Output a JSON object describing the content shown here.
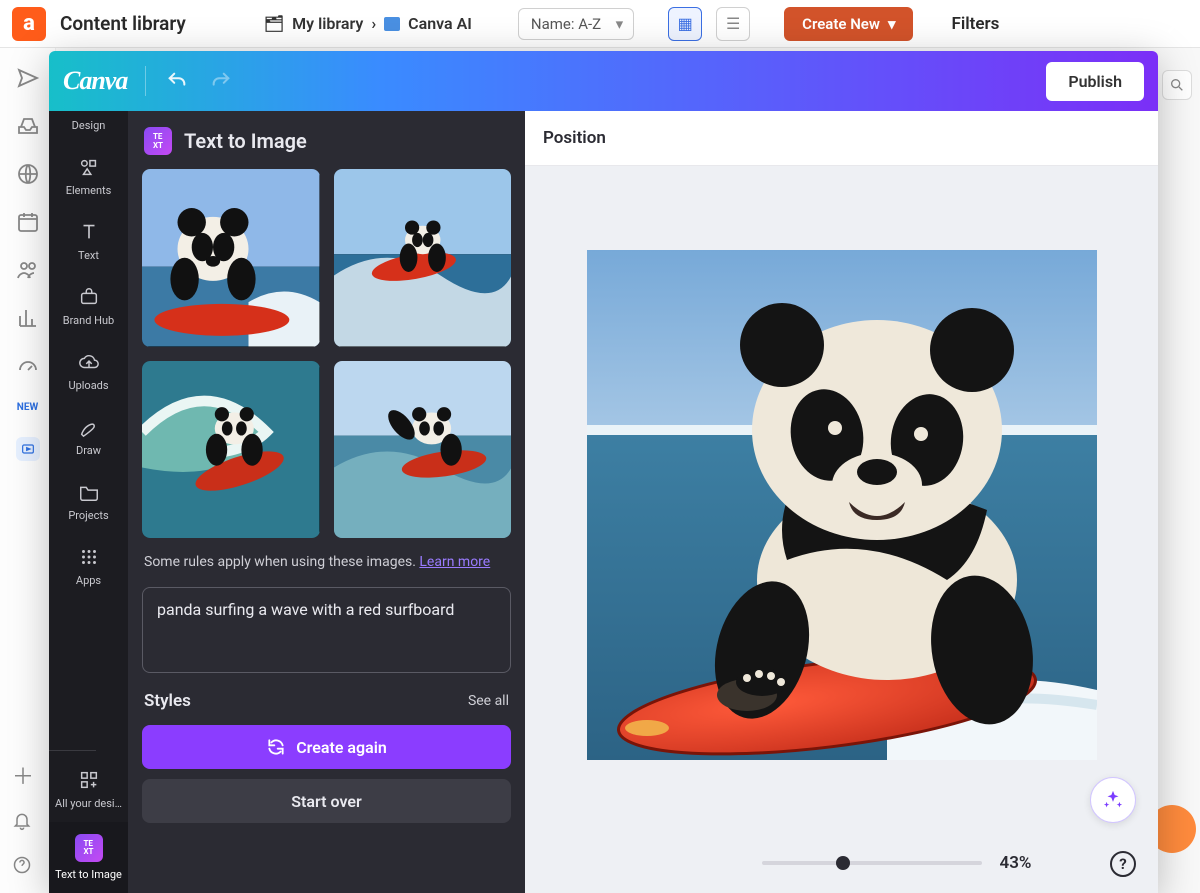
{
  "bg": {
    "title": "Content library",
    "breadcrumb": {
      "root": "My library",
      "current": "Canva AI"
    },
    "sort_label": "Name: A-Z",
    "create_new": "Create New",
    "filters": "Filters",
    "new_badge": "NEW"
  },
  "editor": {
    "logo_text": "Canva",
    "publish": "Publish",
    "position": "Position",
    "zoom_pct": "43%",
    "zoom_value": 0.37
  },
  "rail": {
    "design": "Design",
    "elements": "Elements",
    "text": "Text",
    "brand_hub": "Brand Hub",
    "uploads": "Uploads",
    "draw": "Draw",
    "projects": "Projects",
    "apps": "Apps",
    "all_designs": "All your desi…",
    "text_to_image": "Text to Image"
  },
  "panel": {
    "title": "Text to Image",
    "rules_prefix": "Some rules apply when using these images. ",
    "rules_link": "Learn more",
    "prompt": "panda surfing a wave with a red surfboard",
    "styles_label": "Styles",
    "see_all": "See all",
    "create_again": "Create again",
    "start_over": "Start over"
  }
}
